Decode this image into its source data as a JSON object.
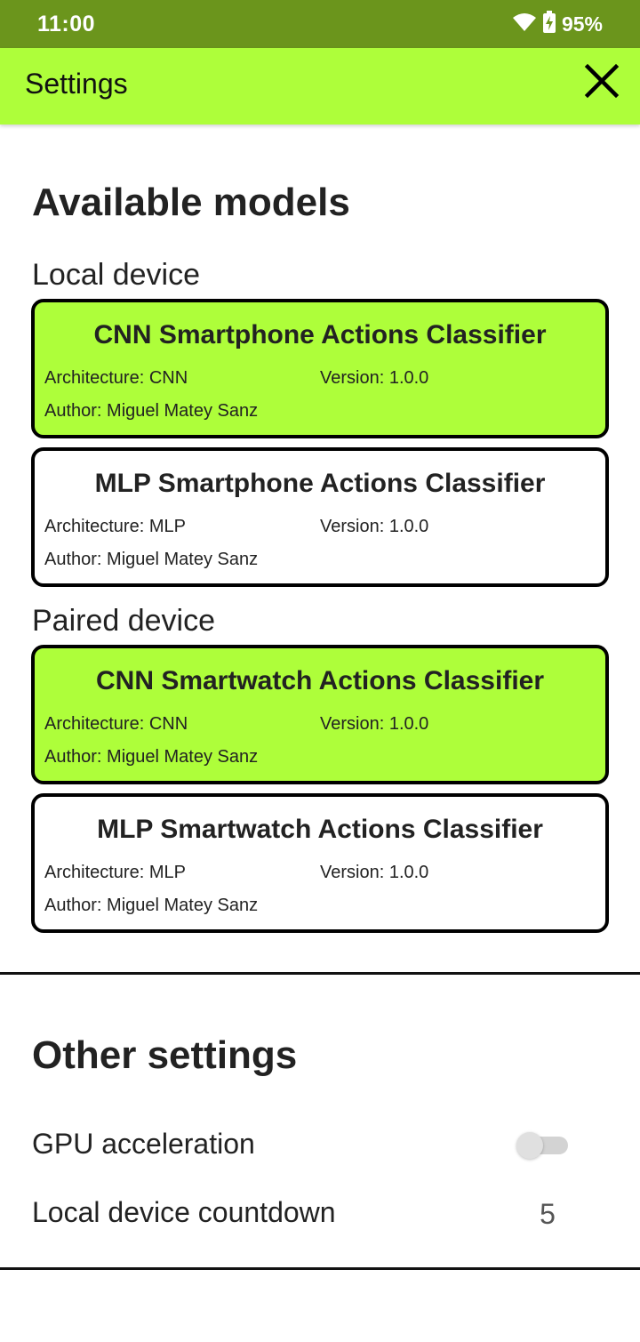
{
  "status_bar": {
    "time": "11:00",
    "battery": "95%",
    "icons": [
      "wifi-icon",
      "battery-charging-icon"
    ]
  },
  "app_bar": {
    "title": "Settings",
    "close_icon": "close-icon"
  },
  "available_models": {
    "title": "Available models",
    "local": {
      "label": "Local device",
      "models": [
        {
          "name": "CNN Smartphone Actions Classifier",
          "architecture": "Architecture: CNN",
          "version": "Version: 1.0.0",
          "author": "Author: Miguel Matey Sanz",
          "selected": true
        },
        {
          "name": "MLP Smartphone Actions Classifier",
          "architecture": "Architecture: MLP",
          "version": "Version: 1.0.0",
          "author": "Author: Miguel Matey Sanz",
          "selected": false
        }
      ]
    },
    "paired": {
      "label": "Paired device",
      "models": [
        {
          "name": "CNN Smartwatch Actions Classifier",
          "architecture": "Architecture: CNN",
          "version": "Version: 1.0.0",
          "author": "Author: Miguel Matey Sanz",
          "selected": true
        },
        {
          "name": "MLP Smartwatch Actions Classifier",
          "architecture": "Architecture: MLP",
          "version": "Version: 1.0.0",
          "author": "Author: Miguel Matey Sanz",
          "selected": false
        }
      ]
    }
  },
  "other_settings": {
    "title": "Other settings",
    "gpu_acceleration": {
      "label": "GPU acceleration",
      "enabled": false
    },
    "local_countdown": {
      "label": "Local device countdown",
      "value": "5"
    }
  },
  "colors": {
    "status_bar": "#6b951c",
    "accent": "#aefe3a",
    "text": "#222222"
  }
}
